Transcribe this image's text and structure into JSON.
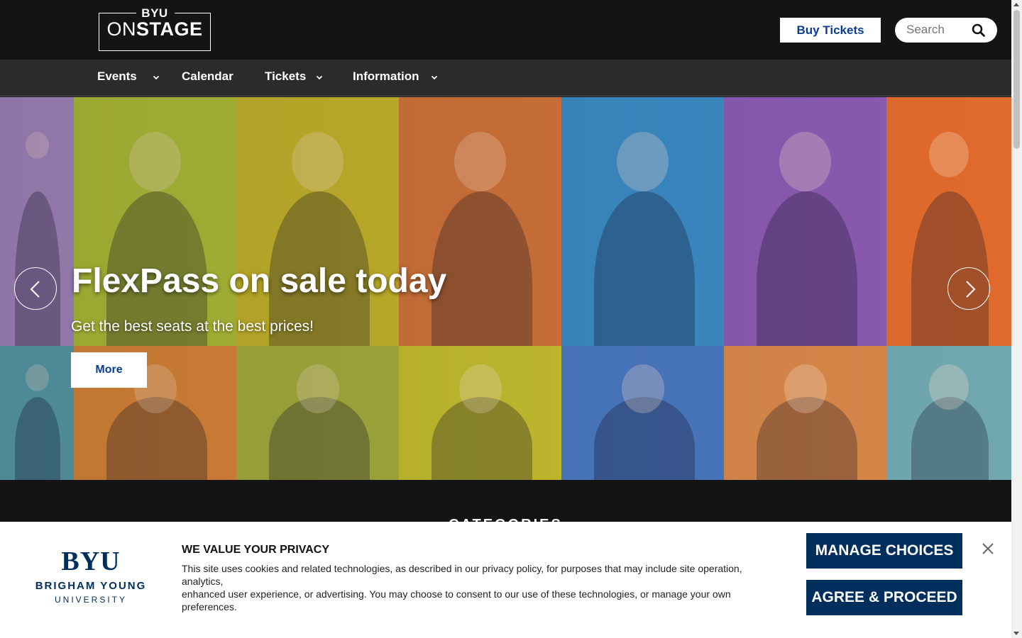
{
  "header": {
    "logo_top": "BYU",
    "logo_on": "ON",
    "logo_stage": "STAGE",
    "buy_tickets_label": "Buy Tickets",
    "search_placeholder": "Search"
  },
  "nav": {
    "items": [
      {
        "label": "Events",
        "has_dropdown": true
      },
      {
        "label": "Calendar",
        "has_dropdown": false
      },
      {
        "label": "Tickets",
        "has_dropdown": true
      },
      {
        "label": "Information",
        "has_dropdown": true
      }
    ]
  },
  "hero": {
    "title": "FlexPass on sale today",
    "subtitle": "Get the best seats at the best prices!",
    "more_label": "More",
    "tile_colors": [
      "#a98ac4",
      "#b3c23a",
      "#c8b62c",
      "#d2743a",
      "#3b8ac4",
      "#8a5ab0",
      "#e06a2c",
      "#5aa0b0",
      "#e08a3a",
      "#a8b040",
      "#c8c030",
      "#4a78c0",
      "#d8884a",
      "#70a8b0"
    ]
  },
  "categories": {
    "title": "CATEGORIES"
  },
  "privacy": {
    "logo_big": "BYU",
    "logo_line1": "BRIGHAM YOUNG",
    "logo_line2": "UNIVERSITY",
    "heading": "WE VALUE YOUR PRIVACY",
    "text_line1": "This site uses cookies and related technologies, as described in our privacy policy, for purposes that may include site operation, analytics,",
    "text_line2": "enhanced user experience, or advertising. You may choose to consent to our use of these technologies, or manage your own preferences.",
    "manage_label": "MANAGE CHOICES",
    "agree_label": "AGREE & PROCEED"
  },
  "colors": {
    "brand_navy": "#002e5d",
    "link_blue": "#0b3d91",
    "header_bg": "#141414",
    "nav_bg": "#2b2b2b"
  }
}
